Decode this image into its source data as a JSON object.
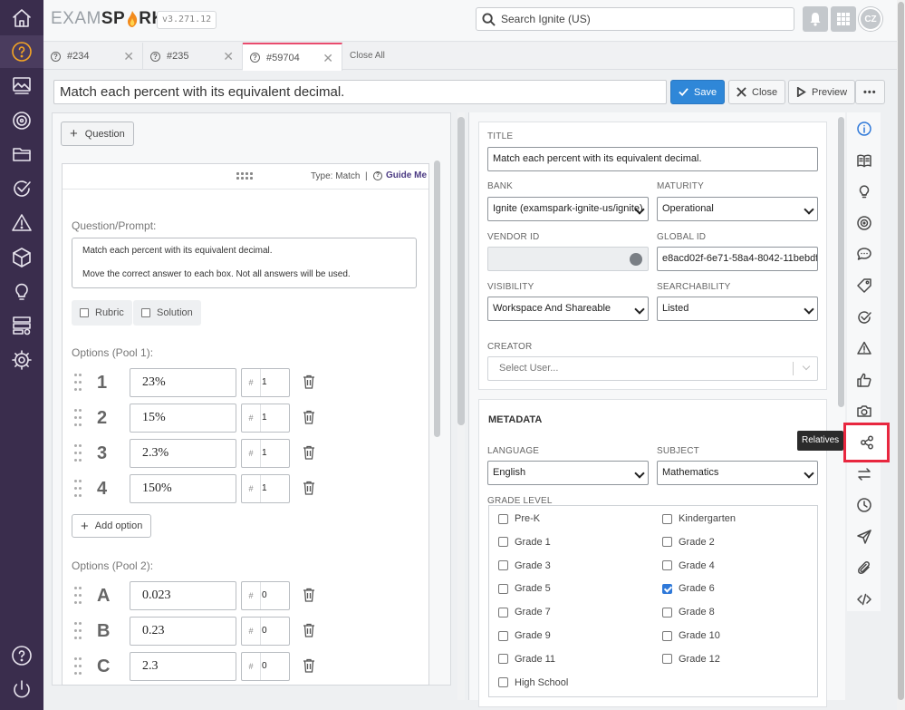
{
  "app": {
    "logo_left": "EXAM",
    "logo_right": "SP",
    "logo_tail": "RK",
    "version": "v3.271.12",
    "search_placeholder": "Search Ignite (US)",
    "avatar_initials": "CZ"
  },
  "rail_icons": [
    "home-icon",
    "help-icon",
    "image-gallery-icon",
    "target-icon",
    "folder-icon",
    "check-circle-icon",
    "warning-icon",
    "cube-icon",
    "lightbulb-icon",
    "server-settings-icon",
    "gear-icon",
    "help-circle-icon",
    "power-icon"
  ],
  "tabs": [
    {
      "label": "#234"
    },
    {
      "label": "#235"
    },
    {
      "label": "#59704"
    }
  ],
  "close_all": "Close All",
  "title_bar": {
    "title_value": "Match each percent with its equivalent decimal.",
    "save": "Save",
    "close": "Close",
    "preview": "Preview",
    "more": "•••"
  },
  "editor": {
    "add_question": "Question",
    "type_label": "Type: Match",
    "guide_me": "Guide Me",
    "prompt_label": "Question/Prompt:",
    "prompt_line1": "Match each percent with its equivalent decimal.",
    "prompt_line2": "Move the correct answer to each box. Not all answers will be used.",
    "rubric": "Rubric",
    "solution": "Solution",
    "pool1_label": "Options (Pool 1):",
    "pool1": [
      {
        "label": "1",
        "value": "23%",
        "num": "1"
      },
      {
        "label": "2",
        "value": "15%",
        "num": "1"
      },
      {
        "label": "3",
        "value": "2.3%",
        "num": "1"
      },
      {
        "label": "4",
        "value": "150%",
        "num": "1"
      }
    ],
    "add_option": "Add option",
    "pool2_label": "Options (Pool 2):",
    "pool2": [
      {
        "label": "A",
        "value": "0.023",
        "num": "0"
      },
      {
        "label": "B",
        "value": "0.23",
        "num": "0"
      },
      {
        "label": "C",
        "value": "2.3",
        "num": "0"
      }
    ],
    "hash": "#"
  },
  "properties": {
    "title_label": "TITLE",
    "title_value": "Match each percent with its equivalent decimal.",
    "bank_label": "BANK",
    "bank_value": "Ignite (examspark-ignite-us/ignite)",
    "maturity_label": "MATURITY",
    "maturity_value": "Operational",
    "vendor_id_label": "VENDOR ID",
    "vendor_id_value": "",
    "global_id_label": "GLOBAL ID",
    "global_id_value": "e8acd02f-6e71-58a4-8042-11bebdf",
    "visibility_label": "VISIBILITY",
    "visibility_value": "Workspace And Shareable",
    "searchability_label": "SEARCHABILITY",
    "searchability_value": "Listed",
    "creator_label": "CREATOR",
    "creator_placeholder": "Select User..."
  },
  "metadata": {
    "heading": "METADATA",
    "language_label": "LANGUAGE",
    "language_value": "English",
    "subject_label": "SUBJECT",
    "subject_value": "Mathematics",
    "grade_label": "GRADE LEVEL",
    "grades": [
      {
        "name": "Pre-K",
        "checked": false
      },
      {
        "name": "Kindergarten",
        "checked": false
      },
      {
        "name": "Grade 1",
        "checked": false
      },
      {
        "name": "Grade 2",
        "checked": false
      },
      {
        "name": "Grade 3",
        "checked": false
      },
      {
        "name": "Grade 4",
        "checked": false
      },
      {
        "name": "Grade 5",
        "checked": false
      },
      {
        "name": "Grade 6",
        "checked": true
      },
      {
        "name": "Grade 7",
        "checked": false
      },
      {
        "name": "Grade 8",
        "checked": false
      },
      {
        "name": "Grade 9",
        "checked": false
      },
      {
        "name": "Grade 10",
        "checked": false
      },
      {
        "name": "Grade 11",
        "checked": false
      },
      {
        "name": "Grade 12",
        "checked": false
      },
      {
        "name": "High School",
        "checked": false
      }
    ]
  },
  "toolbar_icons": [
    "info-icon",
    "book-icon",
    "lightbulb-icon",
    "target-icon",
    "comment-icon",
    "tag-icon",
    "check-circle-icon",
    "warning-icon",
    "thumbs-up-icon",
    "camera-icon",
    "relatives-icon",
    "swap-icon",
    "history-icon",
    "send-icon",
    "paperclip-icon",
    "code-icon"
  ],
  "tooltip": "Relatives"
}
